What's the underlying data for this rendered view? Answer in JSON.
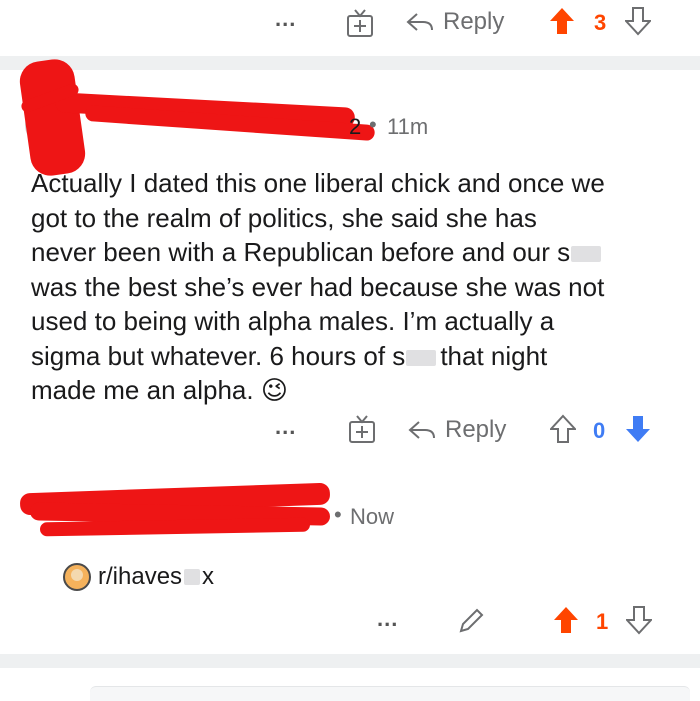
{
  "top_actions": {
    "more": "...",
    "reply_label": "Reply",
    "vote_count": "3"
  },
  "comment1": {
    "username_suffix": "2",
    "time": "11m",
    "lines": [
      "Actually I dated this one liberal chick and once we",
      "got to the realm of politics, she said she has",
      "never been with a Republican before and our s",
      "was the best she’s ever had because she was not",
      "used to being with alpha males. I’m actually a",
      "sigma but whatever. 6 hours of s",
      "that night",
      "made me an alpha."
    ],
    "emoji": "😉",
    "actions": {
      "more": "...",
      "reply_label": "Reply",
      "vote_count": "0"
    }
  },
  "comment2": {
    "time": "Now",
    "text": "r/ihaves",
    "text_tail": "x",
    "actions": {
      "more": "...",
      "vote_count": "1"
    }
  },
  "colors": {
    "upvote": "#ff4500",
    "downvote": "#3f7cf4",
    "redaction": "#ee1515",
    "divider": "#eef0f1"
  },
  "icons": [
    "award-icon",
    "reply-arrow-icon",
    "upvote-icon",
    "downvote-icon",
    "edit-pencil-icon",
    "more-dots-icon",
    "avatar-icon"
  ]
}
